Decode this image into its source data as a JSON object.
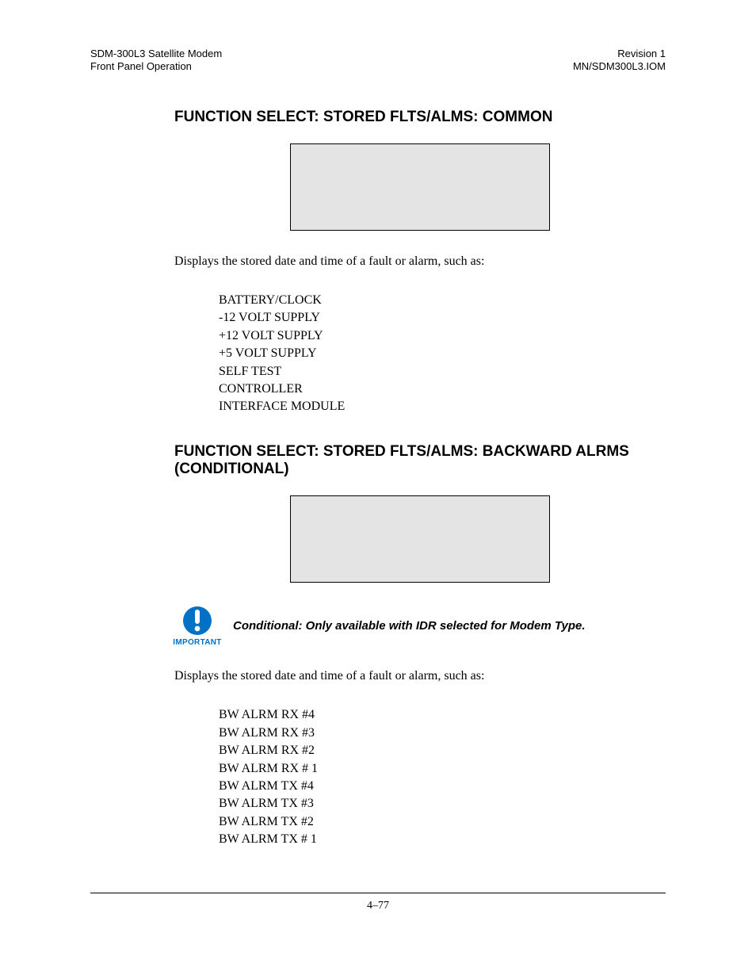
{
  "header": {
    "left1": "SDM-300L3 Satellite Modem",
    "left2": "Front Panel Operation",
    "right1": "Revision 1",
    "right2": "MN/SDM300L3.IOM"
  },
  "section1": {
    "title": "FUNCTION SELECT: STORED FLTS/ALMS: COMMON",
    "intro": "Displays the stored date and time of a fault or alarm, such as:",
    "items": [
      "BATTERY/CLOCK",
      "-12 VOLT SUPPLY",
      "+12 VOLT SUPPLY",
      "+5 VOLT SUPPLY",
      "SELF TEST",
      "CONTROLLER",
      "INTERFACE MODULE"
    ]
  },
  "section2": {
    "title": "FUNCTION SELECT: STORED FLTS/ALMS: BACKWARD ALRMS (CONDITIONAL)",
    "noteCaption": "IMPORTANT",
    "noteText": "Conditional: Only available with IDR selected for Modem Type.",
    "intro": "Displays the stored date and time of a fault or alarm, such as:",
    "items": [
      "BW ALRM RX #4",
      "BW ALRM RX #3",
      "BW ALRM RX #2",
      "BW ALRM RX # 1",
      "BW ALRM TX #4",
      "BW ALRM TX #3",
      "BW ALRM TX #2",
      "BW ALRM TX # 1"
    ]
  },
  "footer": {
    "pageNum": "4–77"
  }
}
